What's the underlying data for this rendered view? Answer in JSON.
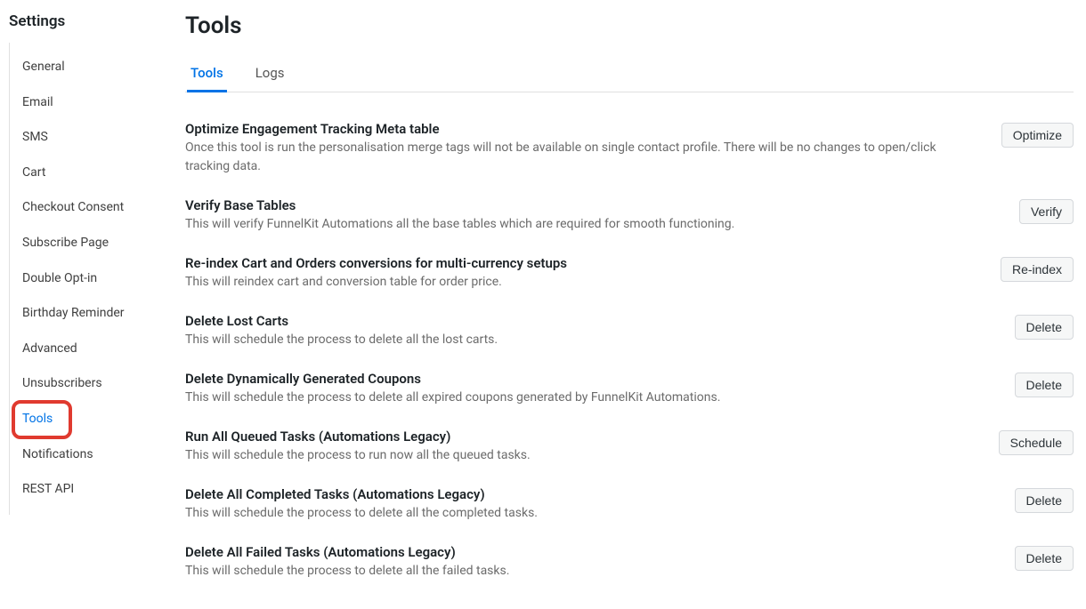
{
  "sidebar": {
    "title": "Settings",
    "items": [
      {
        "label": "General"
      },
      {
        "label": "Email"
      },
      {
        "label": "SMS"
      },
      {
        "label": "Cart"
      },
      {
        "label": "Checkout Consent"
      },
      {
        "label": "Subscribe Page"
      },
      {
        "label": "Double Opt-in"
      },
      {
        "label": "Birthday Reminder"
      },
      {
        "label": "Advanced"
      },
      {
        "label": "Unsubscribers"
      },
      {
        "label": "Tools"
      },
      {
        "label": "Notifications"
      },
      {
        "label": "REST API"
      }
    ]
  },
  "main": {
    "title": "Tools",
    "tabs": [
      {
        "label": "Tools"
      },
      {
        "label": "Logs"
      }
    ],
    "tools": [
      {
        "title": "Optimize Engagement Tracking Meta table",
        "desc": "Once this tool is run the personalisation merge tags will not be available on single contact profile. There will be no changes to open/click tracking data.",
        "button": "Optimize"
      },
      {
        "title": "Verify Base Tables",
        "desc": "This will verify FunnelKit Automations all the base tables which are required for smooth functioning.",
        "button": "Verify"
      },
      {
        "title": "Re-index Cart and Orders conversions for multi-currency setups",
        "desc": "This will reindex cart and conversion table for order price.",
        "button": "Re-index"
      },
      {
        "title": "Delete Lost Carts",
        "desc": "This will schedule the process to delete all the lost carts.",
        "button": "Delete"
      },
      {
        "title": "Delete Dynamically Generated Coupons",
        "desc": "This will schedule the process to delete all expired coupons generated by FunnelKit Automations.",
        "button": "Delete"
      },
      {
        "title": "Run All Queued Tasks (Automations Legacy)",
        "desc": "This will schedule the process to run now all the queued tasks.",
        "button": "Schedule"
      },
      {
        "title": "Delete All Completed Tasks (Automations Legacy)",
        "desc": "This will schedule the process to delete all the completed tasks.",
        "button": "Delete"
      },
      {
        "title": "Delete All Failed Tasks (Automations Legacy)",
        "desc": "This will schedule the process to delete all the failed tasks.",
        "button": "Delete"
      }
    ]
  }
}
